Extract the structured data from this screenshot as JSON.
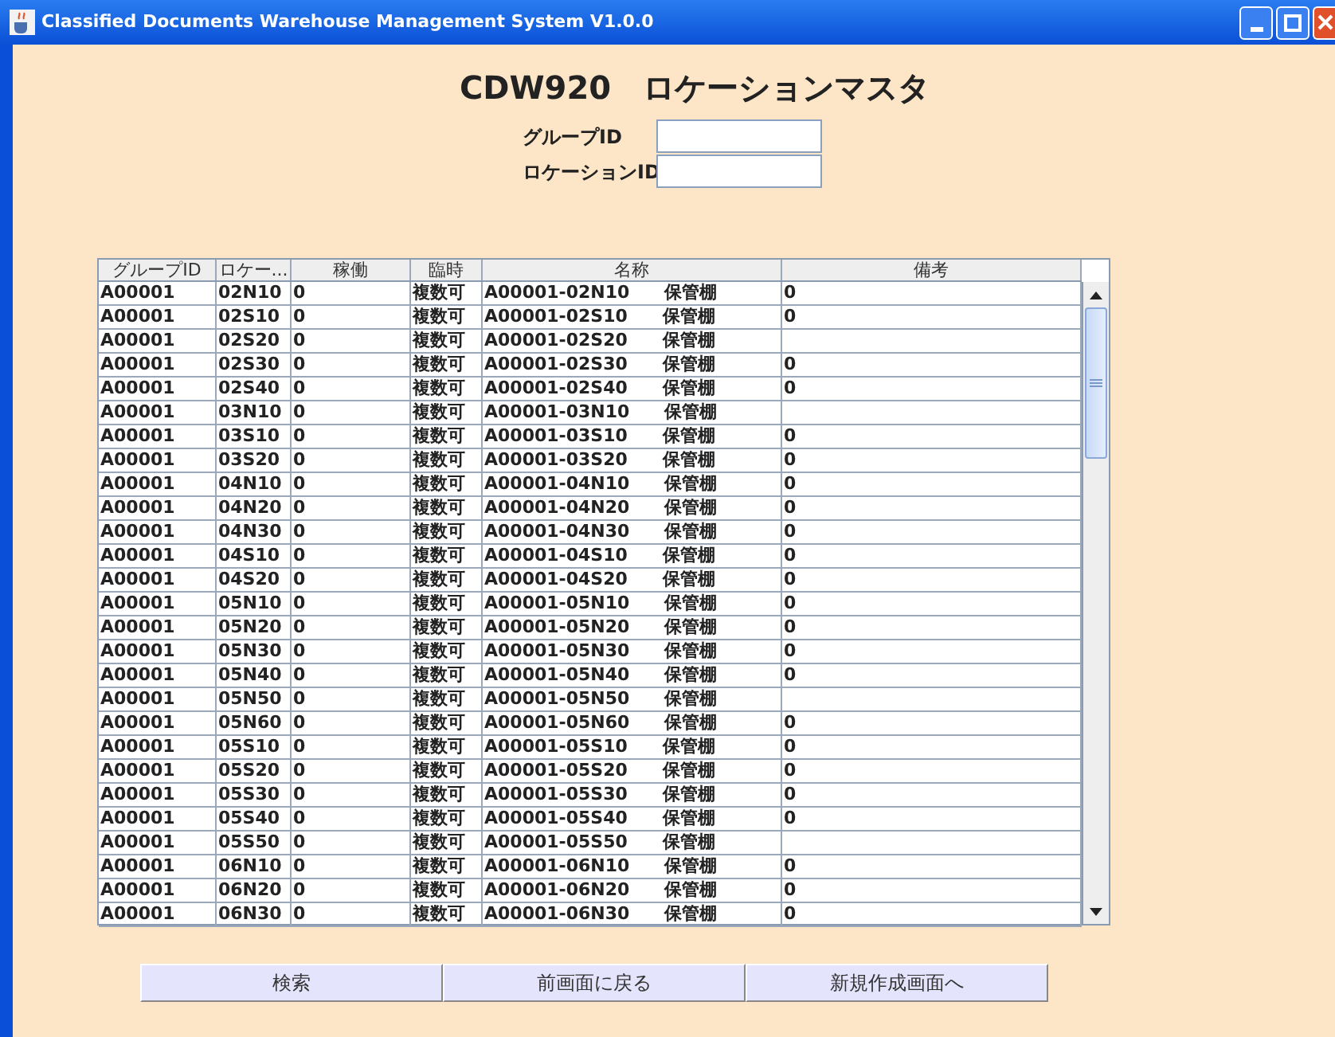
{
  "window": {
    "title": "Classified Documents Warehouse Management System V1.0.0"
  },
  "heading": "CDW920　ロケーションマスタ",
  "fields": [
    {
      "label": "グループID"
    },
    {
      "label": "ロケーションID"
    }
  ],
  "table": {
    "columns": [
      "グループID",
      "ロケー...",
      "稼働",
      "臨時",
      "名称",
      "備考"
    ],
    "rows": [
      {
        "group": "A00001",
        "location": "02N10",
        "active": "0",
        "temp": "複数可",
        "name": "A00001-02N10　　保管棚",
        "note": "0"
      },
      {
        "group": "A00001",
        "location": "02S10",
        "active": "0",
        "temp": "複数可",
        "name": "A00001-02S10　　保管棚",
        "note": "0"
      },
      {
        "group": "A00001",
        "location": "02S20",
        "active": "0",
        "temp": "複数可",
        "name": "A00001-02S20　　保管棚"
      },
      {
        "group": "A00001",
        "location": "02S30",
        "active": "0",
        "temp": "複数可",
        "name": "A00001-02S30　　保管棚",
        "note": "0"
      },
      {
        "group": "A00001",
        "location": "02S40",
        "active": "0",
        "temp": "複数可",
        "name": "A00001-02S40　　保管棚",
        "note": "0"
      },
      {
        "group": "A00001",
        "location": "03N10",
        "active": "0",
        "temp": "複数可",
        "name": "A00001-03N10　　保管棚"
      },
      {
        "group": "A00001",
        "location": "03S10",
        "active": "0",
        "temp": "複数可",
        "name": "A00001-03S10　　保管棚",
        "note": "0"
      },
      {
        "group": "A00001",
        "location": "03S20",
        "active": "0",
        "temp": "複数可",
        "name": "A00001-03S20　　保管棚",
        "note": "0"
      },
      {
        "group": "A00001",
        "location": "04N10",
        "active": "0",
        "temp": "複数可",
        "name": "A00001-04N10　　保管棚",
        "note": "0"
      },
      {
        "group": "A00001",
        "location": "04N20",
        "active": "0",
        "temp": "複数可",
        "name": "A00001-04N20　　保管棚",
        "note": "0"
      },
      {
        "group": "A00001",
        "location": "04N30",
        "active": "0",
        "temp": "複数可",
        "name": "A00001-04N30　　保管棚",
        "note": "0"
      },
      {
        "group": "A00001",
        "location": "04S10",
        "active": "0",
        "temp": "複数可",
        "name": "A00001-04S10　　保管棚",
        "note": "0"
      },
      {
        "group": "A00001",
        "location": "04S20",
        "active": "0",
        "temp": "複数可",
        "name": "A00001-04S20　　保管棚",
        "note": "0"
      },
      {
        "group": "A00001",
        "location": "05N10",
        "active": "0",
        "temp": "複数可",
        "name": "A00001-05N10　　保管棚",
        "note": "0"
      },
      {
        "group": "A00001",
        "location": "05N20",
        "active": "0",
        "temp": "複数可",
        "name": "A00001-05N20　　保管棚",
        "note": "0"
      },
      {
        "group": "A00001",
        "location": "05N30",
        "active": "0",
        "temp": "複数可",
        "name": "A00001-05N30　　保管棚",
        "note": "0"
      },
      {
        "group": "A00001",
        "location": "05N40",
        "active": "0",
        "temp": "複数可",
        "name": "A00001-05N40　　保管棚",
        "note": "0"
      },
      {
        "group": "A00001",
        "location": "05N50",
        "active": "0",
        "temp": "複数可",
        "name": "A00001-05N50　　保管棚"
      },
      {
        "group": "A00001",
        "location": "05N60",
        "active": "0",
        "temp": "複数可",
        "name": "A00001-05N60　　保管棚",
        "note": "0"
      },
      {
        "group": "A00001",
        "location": "05S10",
        "active": "0",
        "temp": "複数可",
        "name": "A00001-05S10　　保管棚",
        "note": "0"
      },
      {
        "group": "A00001",
        "location": "05S20",
        "active": "0",
        "temp": "複数可",
        "name": "A00001-05S20　　保管棚",
        "note": "0"
      },
      {
        "group": "A00001",
        "location": "05S30",
        "active": "0",
        "temp": "複数可",
        "name": "A00001-05S30　　保管棚",
        "note": "0"
      },
      {
        "group": "A00001",
        "location": "05S40",
        "active": "0",
        "temp": "複数可",
        "name": "A00001-05S40　　保管棚",
        "note": "0"
      },
      {
        "group": "A00001",
        "location": "05S50",
        "active": "0",
        "temp": "複数可",
        "name": "A00001-05S50　　保管棚"
      },
      {
        "group": "A00001",
        "location": "06N10",
        "active": "0",
        "temp": "複数可",
        "name": "A00001-06N10　　保管棚",
        "note": "0"
      },
      {
        "group": "A00001",
        "location": "06N20",
        "active": "0",
        "temp": "複数可",
        "name": "A00001-06N20　　保管棚",
        "note": "0"
      },
      {
        "group": "A00001",
        "location": "06N30",
        "active": "0",
        "temp": "複数可",
        "name": "A00001-06N30　　保管棚",
        "note": "0"
      }
    ]
  },
  "buttons": [
    "検索",
    "前画面に戻る",
    "新規作成画面へ"
  ]
}
